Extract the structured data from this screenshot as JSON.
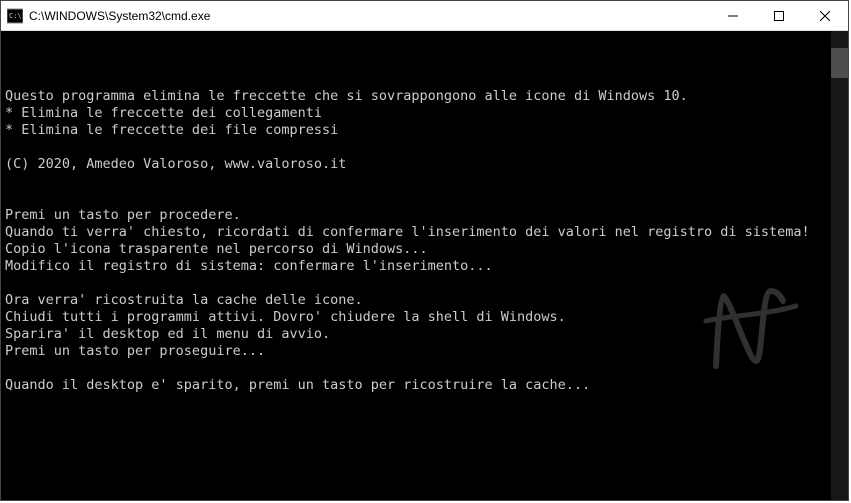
{
  "window": {
    "title": "C:\\WINDOWS\\System32\\cmd.exe"
  },
  "console": {
    "lines": [
      "Questo programma elimina le freccette che si sovrappongono alle icone di Windows 10.",
      "* Elimina le freccette dei collegamenti",
      "* Elimina le freccette dei file compressi",
      "",
      "(C) 2020, Amedeo Valoroso, www.valoroso.it",
      "",
      "",
      "Premi un tasto per procedere.",
      "Quando ti verra' chiesto, ricordati di confermare l'inserimento dei valori nel registro di sistema!",
      "Copio l'icona trasparente nel percorso di Windows...",
      "Modifico il registro di sistema: confermare l'inserimento...",
      "",
      "Ora verra' ricostruita la cache delle icone.",
      "Chiudi tutti i programmi attivi. Dovro' chiudere la shell di Windows.",
      "Sparira' il desktop ed il menu di avvio.",
      "Premi un tasto per proseguire...",
      "",
      "Quando il desktop e' sparito, premi un tasto per ricostruire la cache..."
    ]
  }
}
